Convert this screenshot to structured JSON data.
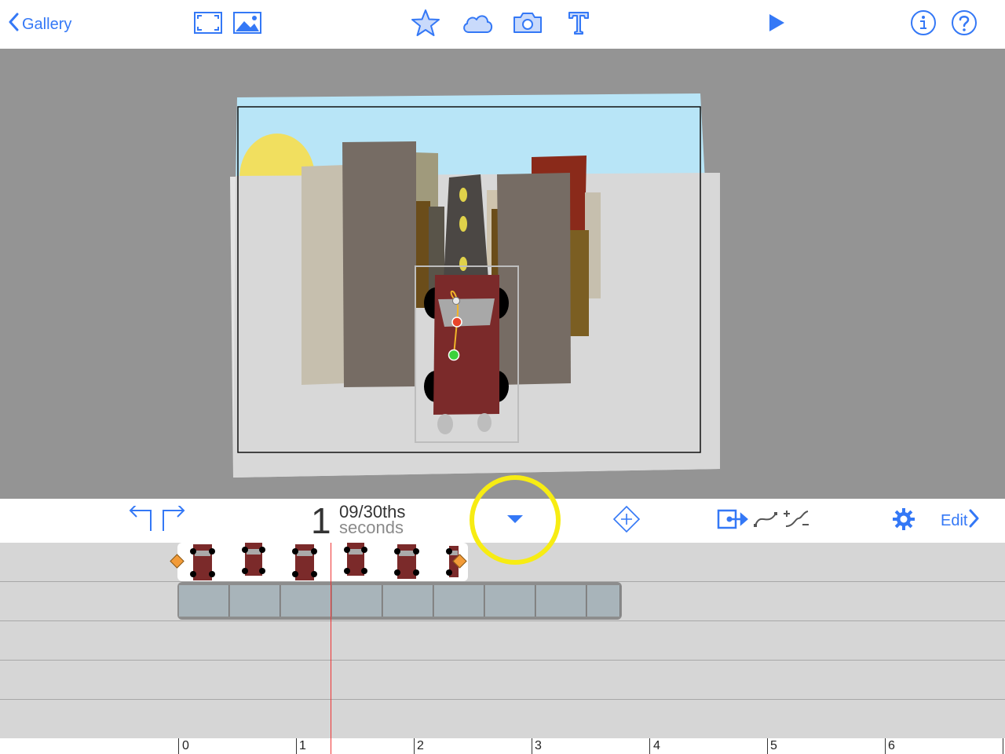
{
  "toolbar": {
    "back_label": "Gallery",
    "icons": [
      "fullscreen-icon",
      "image-icon",
      "star-icon",
      "cloud-icon",
      "camera-icon",
      "text-icon",
      "play-icon",
      "info-icon",
      "help-icon"
    ]
  },
  "controls": {
    "time_seconds": "1",
    "time_fraction": "09/30ths",
    "time_unit": "seconds",
    "edit_label": "Edit",
    "icons": [
      "undo-icon",
      "redo-icon",
      "dropdown-arrow-icon",
      "add-keyframe-icon",
      "export-motion-icon",
      "path-curve-icon",
      "ease-icon",
      "settings-gear-icon",
      "chevron-right-icon"
    ]
  },
  "timeline": {
    "ruler_labels": [
      "0",
      "1",
      "2",
      "3",
      "4",
      "5",
      "6"
    ],
    "tracks": [
      "car-track",
      "background-track",
      "empty-track",
      "empty-track",
      "empty-track"
    ]
  },
  "colors": {
    "accent": "#3478f6",
    "stage": "#949494",
    "sky": "#b8e5f7",
    "sun": "#f1df5f",
    "car": "#7b2a2a",
    "keyframe": "#f29b38",
    "playhead": "#e33333",
    "highlight": "#f7ec13"
  }
}
